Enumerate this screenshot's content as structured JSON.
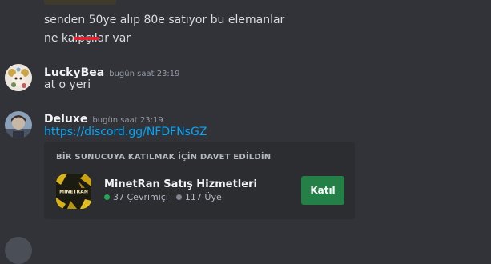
{
  "messages": [
    {
      "continuation_lines": [
        "senden 50ye alıp 80e satıyor bu elemanlar",
        "ne kalpçılar var"
      ]
    },
    {
      "username": "LuckyBea",
      "timestamp": "bugün saat 23:19",
      "text": "at o yeri"
    },
    {
      "username": "Deluxe",
      "timestamp": "bugün saat 23:19",
      "link": "https://discord.gg/NFDFNsGZ"
    }
  ],
  "invite": {
    "header": "BİR SUNUCUYA KATILMAK İÇİN DAVET EDİLDİN",
    "server_name": "MinetRan Satış Hizmetleri",
    "online": "37 Çevrimiçi",
    "members": "117 Üye",
    "join_label": "Katıl",
    "icon_text": "MINETRAN"
  },
  "colors": {
    "background": "#313338",
    "link": "#00a8fc",
    "join_button": "#248046",
    "online_dot": "#23a55a",
    "redaction": "#e4222f"
  }
}
